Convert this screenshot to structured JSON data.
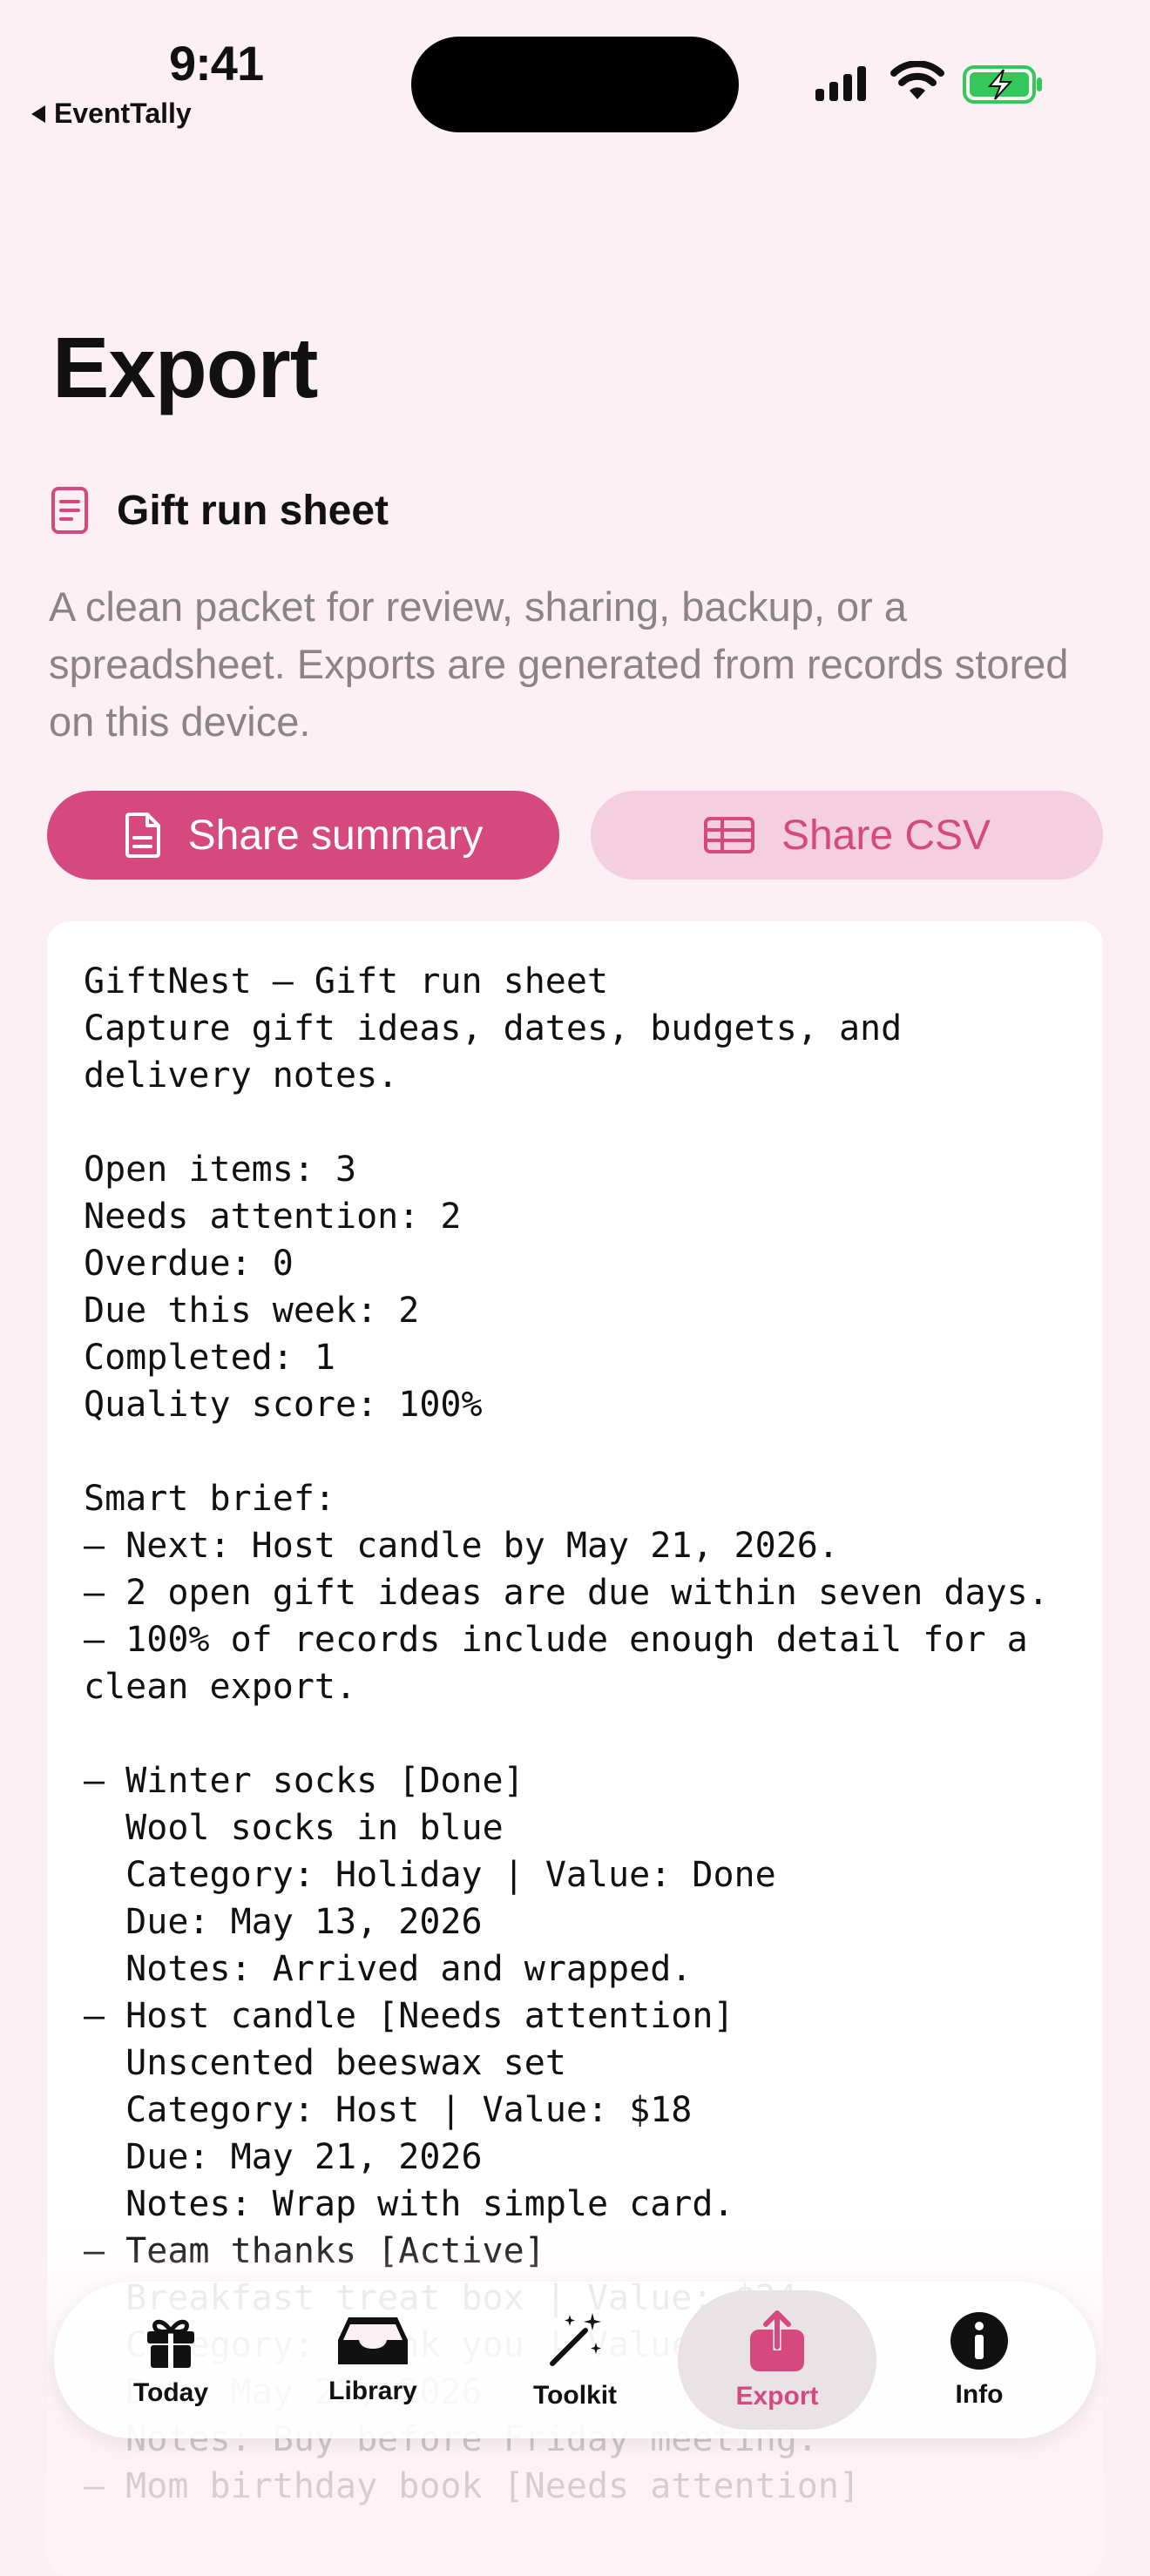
{
  "status": {
    "time": "9:41",
    "back_app": "EventTally"
  },
  "page": {
    "title": "Export"
  },
  "section": {
    "label": "Gift run sheet",
    "description": "A clean packet for review, sharing, backup, or a spreadsheet. Exports are generated from records stored on this device."
  },
  "actions": {
    "share_summary": "Share summary",
    "share_csv": "Share CSV"
  },
  "accent_color": "#d6497f",
  "preview": {
    "text": "GiftNest – Gift run sheet\nCapture gift ideas, dates, budgets, and\ndelivery notes.\n\nOpen items: 3\nNeeds attention: 2\nOverdue: 0\nDue this week: 2\nCompleted: 1\nQuality score: 100%\n\nSmart brief:\n– Next: Host candle by May 21, 2026.\n– 2 open gift ideas are due within seven days.\n– 100% of records include enough detail for a\nclean export.\n\n– Winter socks [Done]\n  Wool socks in blue\n  Category: Holiday | Value: Done\n  Due: May 13, 2026\n  Notes: Arrived and wrapped.\n– Host candle [Needs attention]\n  Unscented beeswax set\n  Category: Host | Value: $18\n  Due: May 21, 2026\n  Notes: Wrap with simple card.\n– Team thanks [Active]\n  Breakfast treat box | Value: $24\n  Category: Thank you | Value: $24\n  Due: May 22, 2026\n  Notes: Buy before Friday meeting.\n– Mom birthday book [Needs attention]"
  },
  "tabs": [
    {
      "label": "Today",
      "icon": "gift-icon"
    },
    {
      "label": "Library",
      "icon": "tray-icon"
    },
    {
      "label": "Toolkit",
      "icon": "magic-wand-icon"
    },
    {
      "label": "Export",
      "icon": "share-icon",
      "active": true
    },
    {
      "label": "Info",
      "icon": "info-icon"
    }
  ]
}
